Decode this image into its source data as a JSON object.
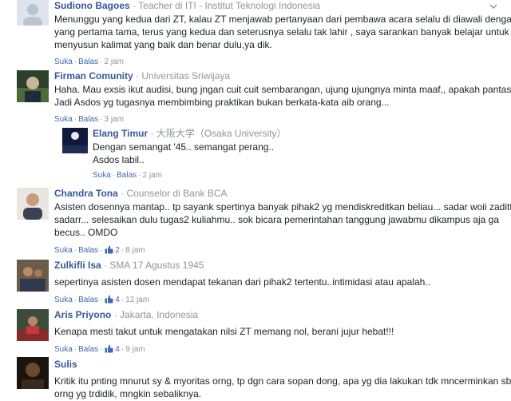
{
  "comments": [
    {
      "name": "Sudiono Bagoes",
      "affiliation": "Teacher di ITI - Institut Teknologi Indonesia",
      "lines": [
        "Menunggu yang kedua dari ZT, kalau ZT menjawab pertanyaan dari pembawa acara selalu di diawali dengan",
        "yang pertama tama, terus yang kedua dan seterusnya selalu tak lahir , saya sarankan banyak belajar untuk",
        "menyusun kalimat yang baik dan benar dulu,ya dik."
      ],
      "like": "Suka",
      "reply": "Balas",
      "time": "2 jam"
    },
    {
      "name": "Firman Comunity",
      "affiliation": "Universitas Sriwijaya",
      "lines": [
        "Haha. Mau exsis ikut audisi, bung jngan cuit cuit sembarangan, ujung ujungnya minta maaf,, apakah pantas",
        "Jadi Asdos yg tugasnya membimbing praktikan bukan berkata-kata aib orang..."
      ],
      "like": "Suka",
      "reply": "Balas",
      "time": "3 jam"
    },
    {
      "name": "Elang Timur",
      "affiliation": "大阪大学（Osaka University）",
      "lines": [
        "Dengan semangat '45.. semangat perang..",
        "Asdos labil.."
      ],
      "like": "Suka",
      "reply": "Balas",
      "time": "2 jam"
    },
    {
      "name": "Chandra Tona",
      "affiliation": "Counselor di Bank BCA",
      "lines": [
        "Asisten dosennya mantap.. tp sayank spertinya banyak pihak2 yg mendiskreditkan beliau... sadar woii zaditt",
        "sadarr... selesaikan dulu tugas2 kuliahmu.. sok bicara pemerintahan tanggung jawabmu dikampus aja ga",
        "becus.. OMDO"
      ],
      "like": "Suka",
      "reply": "Balas",
      "likes": "2",
      "time": "8 jam"
    },
    {
      "name": "Zulkifli Isa",
      "affiliation": "SMA 17 Agustus 1945",
      "lines": [
        "sepertinya asisten dosen mendapat tekanan dari pihak2 tertentu..intimidasi atau apalah.."
      ],
      "like": "Suka",
      "reply": "Balas",
      "likes": "4",
      "time": "12 jam"
    },
    {
      "name": "Aris Priyono",
      "affiliation": "Jakarta, Indonesia",
      "lines": [
        "Kenapa mesti takut untuk mengatakan nilsi ZT memang nol, berani jujur hebat!!!"
      ],
      "like": "Suka",
      "reply": "Balas",
      "likes": "4",
      "time": "9 jam"
    },
    {
      "name": "Sulis",
      "lines": [
        "Kritik itu pnting mnurut sy & myoritas orng, tp dgn cara sopan dong, apa yg dia lakukan tdk mncerminkan sbgai",
        "orng yg trdidik, mngkin sebaliknya."
      ]
    }
  ],
  "colors": {
    "name": "#365899",
    "link": "#4267b2",
    "meta": "#90949c",
    "text": "#1d2129"
  },
  "icons": {
    "like_badge": "thumbs-up-icon",
    "menu": "chevron-down-icon"
  }
}
